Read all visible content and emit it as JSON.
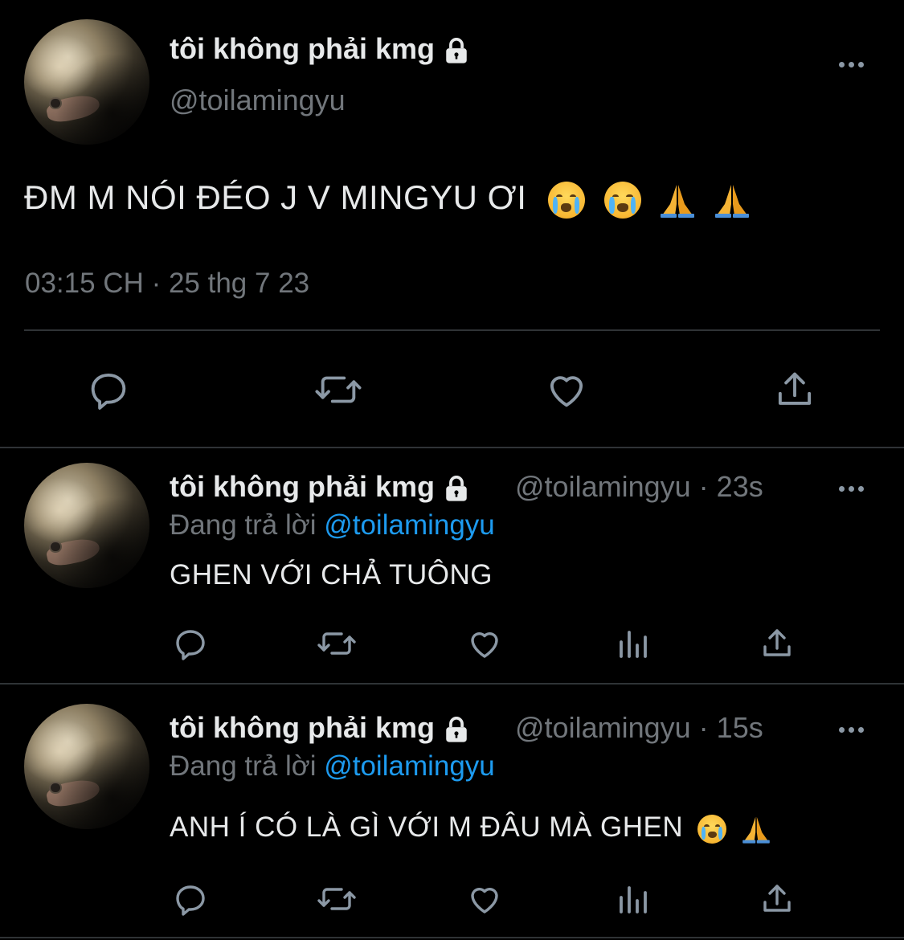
{
  "main_tweet": {
    "display_name": "tôi không phải kmg",
    "handle": "@toilamingyu",
    "text": "ĐM M NÓI ĐÉO J V MINGYU ƠI",
    "text_emojis": [
      "loudly-crying-face",
      "loudly-crying-face",
      "folded-hands",
      "folded-hands"
    ],
    "timestamp": "03:15 CH · 25 thg 7 23",
    "actions": [
      "reply",
      "retweet",
      "like",
      "share"
    ]
  },
  "replies": [
    {
      "display_name": "tôi không phải kmg",
      "handle": "@toilamingyu",
      "separator": "·",
      "time": "23s",
      "replying_prefix": "Đang trả lời",
      "replying_to": "@toilamingyu",
      "text": "GHEN VỚI CHẢ TUÔNG",
      "text_emojis": [],
      "actions": [
        "reply",
        "retweet",
        "like",
        "views",
        "share"
      ]
    },
    {
      "display_name": "tôi không phải kmg",
      "handle": "@toilamingyu",
      "separator": "·",
      "time": "15s",
      "replying_prefix": "Đang trả lời",
      "replying_to": "@toilamingyu",
      "text": "ANH Í CÓ LÀ GÌ VỚI M ĐÂU MÀ GHEN",
      "text_emojis": [
        "loudly-crying-face",
        "folded-hands"
      ],
      "actions": [
        "reply",
        "retweet",
        "like",
        "views",
        "share"
      ]
    }
  ],
  "colors": {
    "background": "#000000",
    "primary_text": "#e7e9ea",
    "secondary_text": "#71767b",
    "mention": "#1d9bf0",
    "icon": "#8b98a5",
    "divider": "#2f3336"
  }
}
